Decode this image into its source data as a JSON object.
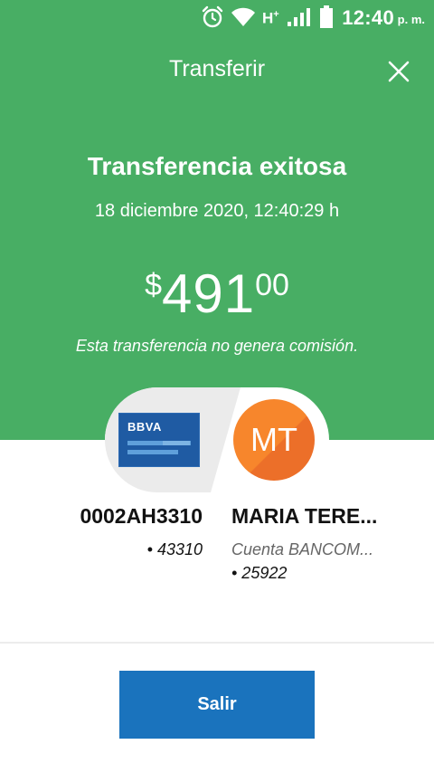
{
  "status_bar": {
    "network_label": "H",
    "network_sup": "+",
    "time": "12:40",
    "ampm": "p. m.",
    "icons": [
      "alarm-icon",
      "wifi-icon",
      "signal-icon",
      "battery-icon"
    ]
  },
  "header": {
    "title": "Transferir",
    "close_icon": "close-icon"
  },
  "result": {
    "title": "Transferencia exitosa",
    "datetime": "18 diciembre 2020, 12:40:29 h",
    "currency_symbol": "$",
    "amount_integer": "491",
    "amount_decimal": "00",
    "fee_note": "Esta transferencia no genera comisión."
  },
  "origin": {
    "bank_logo": "BBVA",
    "name": "0002AH3310",
    "account": "• 43310"
  },
  "destination": {
    "initials": "MT",
    "name": "MARIA TERE...",
    "bank": "Cuenta BANCOM...",
    "account": "• 25922"
  },
  "actions": {
    "exit_label": "Salir"
  },
  "colors": {
    "header_bg": "#48ae64",
    "button_bg": "#1a73bd",
    "card_bg": "#1f5ba3",
    "avatar_bg": "#f7862c"
  }
}
